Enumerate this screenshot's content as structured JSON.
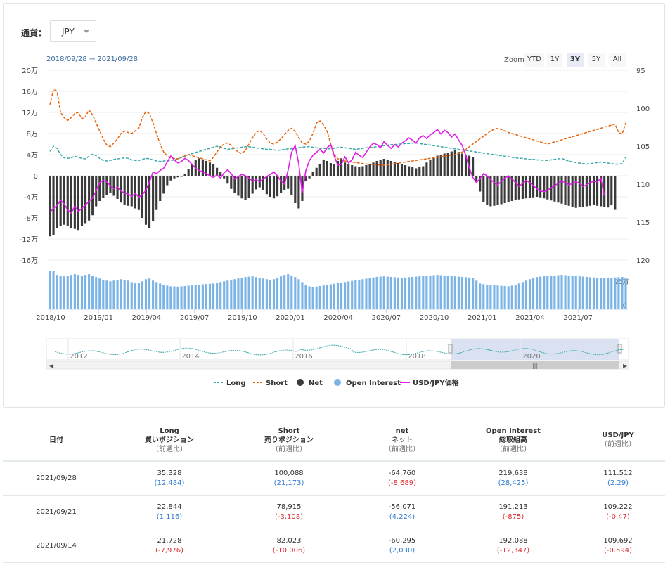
{
  "currency": {
    "label": "通貨：",
    "selected": "JPY"
  },
  "range": {
    "from": "2018/09/28",
    "arrow": "→",
    "to": "2021/09/28"
  },
  "zoom": {
    "label": "Zoom",
    "buttons": [
      "YTD",
      "1Y",
      "3Y",
      "5Y",
      "All"
    ],
    "active": "3Y"
  },
  "colors": {
    "long": "#3aa8a8",
    "short": "#e8650c",
    "net": "#3a3a3a",
    "open_interest": "#7ab3e6",
    "usdjpy": "#e21ce8"
  },
  "chart_data": {
    "type": "line",
    "y_left": {
      "ticks": [
        "20万",
        "16万",
        "12万",
        "8万",
        "4万",
        "0",
        "-4万",
        "-8万",
        "-12万",
        "-16万"
      ],
      "range": [
        -160000,
        200000
      ]
    },
    "y_right": {
      "ticks": [
        "95",
        "100",
        "105",
        "110",
        "115",
        "120"
      ],
      "range": [
        95,
        120
      ],
      "reversed": true
    },
    "oi_axis": {
      "ticks": [
        "25万",
        "0"
      ]
    },
    "x_ticks": [
      "2018/10",
      "2019/01",
      "2019/04",
      "2019/07",
      "2019/10",
      "2020/01",
      "2020/04",
      "2020/07",
      "2020/10",
      "2021/01",
      "2021/04",
      "2021/07"
    ],
    "navigator_ticks": [
      "2012",
      "2014",
      "2016",
      "2018",
      "2020"
    ],
    "legend": [
      "Long",
      "Short",
      "Net",
      "Open Interest",
      "USD/JPY価格"
    ],
    "series": [
      {
        "name": "Long",
        "kind": "line",
        "values": [
          46000,
          56000,
          52000,
          40000,
          34000,
          33000,
          34000,
          37000,
          35000,
          33000,
          32000,
          37000,
          41000,
          38000,
          33000,
          29000,
          28000,
          29000,
          31000,
          32000,
          33000,
          34000,
          33000,
          30000,
          29000,
          29000,
          31000,
          33000,
          32000,
          30000,
          28000,
          27000,
          28000,
          28000,
          29000,
          30000,
          32000,
          35000,
          37000,
          40000,
          42000,
          44000,
          46000,
          48000,
          50000,
          52000,
          54000,
          56000,
          55000,
          52000,
          50000,
          51000,
          52000,
          53000,
          54000,
          55000,
          55000,
          54000,
          53000,
          52000,
          51000,
          50000,
          50000,
          49000,
          48000,
          49000,
          50000,
          51000,
          51000,
          52000,
          53000,
          54000,
          55000,
          55000,
          54000,
          53000,
          52000,
          52000,
          51000,
          51000,
          52000,
          53000,
          54000,
          53000,
          52000,
          51000,
          50000,
          51000,
          52000,
          53000,
          53000,
          54000,
          55000,
          56000,
          57000,
          58000,
          59000,
          59000,
          60000,
          60000,
          61000,
          61000,
          62000,
          62000,
          61000,
          60000,
          59000,
          58000,
          57000,
          56000,
          55000,
          54000,
          53000,
          52000,
          51000,
          50000,
          49000,
          48000,
          47000,
          46000,
          45000,
          44000,
          43000,
          42000,
          41000,
          40000,
          39000,
          38000,
          37000,
          36000,
          35000,
          34000,
          33000,
          33000,
          32000,
          31000,
          31000,
          30000,
          30000,
          29000,
          29000,
          30000,
          31000,
          32000,
          33000,
          30000,
          28000,
          26000,
          25000,
          24000,
          23000,
          22000,
          23000,
          24000,
          25000,
          26000,
          25000,
          24000,
          23000,
          22000,
          21728,
          22844,
          35328
        ]
      },
      {
        "name": "Short",
        "kind": "line",
        "values": [
          135000,
          164000,
          160000,
          120000,
          110000,
          105000,
          110000,
          118000,
          120000,
          108000,
          112000,
          125000,
          115000,
          100000,
          85000,
          70000,
          58000,
          55000,
          62000,
          70000,
          80000,
          85000,
          82000,
          80000,
          85000,
          90000,
          110000,
          122000,
          118000,
          100000,
          80000,
          60000,
          45000,
          38000,
          34000,
          33000,
          32000,
          35000,
          38000,
          40000,
          38000,
          36000,
          34000,
          32000,
          30000,
          28000,
          35000,
          45000,
          55000,
          60000,
          62000,
          58000,
          50000,
          45000,
          42000,
          48000,
          60000,
          72000,
          82000,
          86000,
          80000,
          70000,
          62000,
          60000,
          64000,
          70000,
          78000,
          86000,
          90000,
          84000,
          72000,
          62000,
          60000,
          66000,
          80000,
          100000,
          104000,
          96000,
          84000,
          60000,
          40000,
          32000,
          30000,
          28000,
          27000,
          26000,
          25000,
          24000,
          23000,
          22000,
          22000,
          21000,
          21000,
          20000,
          20000,
          21000,
          22000,
          23000,
          24000,
          25000,
          26000,
          27000,
          28000,
          29000,
          30000,
          31000,
          32000,
          33000,
          34000,
          35000,
          36000,
          37000,
          38000,
          39000,
          40000,
          42000,
          45000,
          50000,
          55000,
          60000,
          65000,
          70000,
          75000,
          80000,
          85000,
          88000,
          90000,
          88000,
          85000,
          82000,
          80000,
          78000,
          76000,
          74000,
          72000,
          70000,
          68000,
          66000,
          64000,
          62000,
          60000,
          62000,
          64000,
          66000,
          68000,
          70000,
          72000,
          74000,
          76000,
          78000,
          80000,
          82000,
          84000,
          86000,
          88000,
          90000,
          92000,
          94000,
          96000,
          98000,
          82023,
          78915,
          100088
        ]
      },
      {
        "name": "Net",
        "kind": "column",
        "values": [
          -115000,
          -112000,
          -100000,
          -95000,
          -93000,
          -96000,
          -99000,
          -101000,
          -103000,
          -95000,
          -90000,
          -85000,
          -75000,
          -58000,
          -48000,
          -42000,
          -36000,
          -33000,
          -38000,
          -44000,
          -51000,
          -55000,
          -57000,
          -58000,
          -62000,
          -65000,
          -80000,
          -93000,
          -99000,
          -86000,
          -65000,
          -48000,
          -34000,
          -18000,
          -9000,
          -5000,
          -3000,
          -2000,
          4000,
          12000,
          22000,
          30000,
          33000,
          31000,
          28000,
          25000,
          22000,
          15000,
          8000,
          -5000,
          -15000,
          -25000,
          -32000,
          -38000,
          -43000,
          -46000,
          -42000,
          -34000,
          -26000,
          -22000,
          -28000,
          -35000,
          -40000,
          -43000,
          -39000,
          -33000,
          -28000,
          -25000,
          -36000,
          -52000,
          -62000,
          -48000,
          -10000,
          -5000,
          8000,
          15000,
          22000,
          30000,
          28000,
          24000,
          22000,
          28000,
          33000,
          25000,
          22000,
          20000,
          18000,
          16000,
          18000,
          20000,
          22000,
          25000,
          28000,
          30000,
          32000,
          30000,
          28000,
          26000,
          24000,
          22000,
          20000,
          18000,
          16000,
          14000,
          16000,
          18000,
          25000,
          30000,
          35000,
          38000,
          40000,
          42000,
          44000,
          46000,
          48000,
          45000,
          42000,
          40000,
          38000,
          36000,
          -10000,
          -30000,
          -50000,
          -55000,
          -58000,
          -57000,
          -56000,
          -54000,
          -52000,
          -50000,
          -48000,
          -46000,
          -45000,
          -44000,
          -43000,
          -42000,
          -41000,
          -40000,
          -41000,
          -43000,
          -45000,
          -47000,
          -49000,
          -51000,
          -53000,
          -55000,
          -57000,
          -59000,
          -61000,
          -60000,
          -59000,
          -58000,
          -57000,
          -56000,
          -57000,
          -58000,
          -59000,
          -60295,
          -56071,
          -64760
        ]
      },
      {
        "name": "Open Interest",
        "kind": "column",
        "axis": "oi",
        "values": [
          270000,
          270000,
          240000,
          235000,
          230000,
          235000,
          240000,
          245000,
          240000,
          235000,
          240000,
          245000,
          235000,
          225000,
          215000,
          205000,
          200000,
          195000,
          200000,
          205000,
          210000,
          205000,
          200000,
          190000,
          185000,
          185000,
          195000,
          210000,
          215000,
          200000,
          190000,
          180000,
          170000,
          165000,
          160000,
          160000,
          158000,
          160000,
          162000,
          165000,
          168000,
          170000,
          172000,
          174000,
          176000,
          178000,
          180000,
          185000,
          190000,
          195000,
          200000,
          205000,
          210000,
          215000,
          220000,
          225000,
          228000,
          230000,
          225000,
          220000,
          215000,
          210000,
          205000,
          210000,
          220000,
          230000,
          240000,
          245000,
          235000,
          225000,
          210000,
          190000,
          170000,
          160000,
          155000,
          158000,
          162000,
          166000,
          170000,
          174000,
          178000,
          182000,
          186000,
          190000,
          194000,
          198000,
          202000,
          206000,
          210000,
          214000,
          218000,
          222000,
          226000,
          228000,
          230000,
          228000,
          226000,
          224000,
          222000,
          220000,
          222000,
          224000,
          226000,
          228000,
          230000,
          232000,
          234000,
          236000,
          238000,
          240000,
          238000,
          236000,
          234000,
          232000,
          230000,
          228000,
          226000,
          224000,
          222000,
          220000,
          200000,
          180000,
          175000,
          172000,
          170000,
          168000,
          166000,
          164000,
          162000,
          160000,
          165000,
          170000,
          180000,
          190000,
          200000,
          210000,
          220000,
          225000,
          228000,
          230000,
          232000,
          234000,
          236000,
          238000,
          240000,
          238000,
          236000,
          234000,
          232000,
          230000,
          228000,
          226000,
          224000,
          222000,
          220000,
          218000,
          216000,
          218000,
          220000,
          222000,
          224000,
          226000,
          219638
        ]
      },
      {
        "name": "USD/JPY価格",
        "kind": "line",
        "axis": "right",
        "values": [
          113.7,
          113.2,
          112.8,
          112.1,
          112.6,
          113.4,
          113.8,
          112.9,
          113.6,
          113.2,
          112.7,
          112.3,
          111.8,
          110.9,
          109.8,
          109.5,
          109.7,
          110.2,
          110.6,
          110.4,
          110.9,
          111.2,
          111.3,
          111.6,
          111.2,
          111.7,
          111.4,
          110.8,
          109.7,
          108.4,
          108.6,
          108.2,
          107.9,
          107.1,
          106.3,
          106.8,
          107.2,
          107.0,
          106.6,
          106.9,
          107.4,
          107.9,
          108.2,
          108.4,
          108.6,
          108.9,
          109.1,
          108.8,
          109.2,
          108.5,
          108.1,
          108.6,
          109.3,
          109.0,
          108.7,
          108.9,
          109.2,
          109.6,
          109.4,
          109.7,
          109.3,
          109.0,
          108.7,
          108.4,
          108.9,
          109.6,
          110.0,
          108.2,
          105.8,
          104.9,
          107.3,
          111.2,
          108.2,
          106.9,
          106.2,
          105.8,
          105.4,
          105.9,
          105.2,
          104.8,
          106.3,
          107.5,
          107.4,
          106.4,
          107.2,
          106.8,
          105.8,
          106.2,
          106.5,
          105.8,
          105.1,
          104.6,
          104.8,
          105.2,
          104.4,
          104.9,
          105.3,
          104.8,
          105.1,
          104.6,
          104.3,
          103.9,
          104.2,
          104.6,
          103.9,
          103.6,
          104.0,
          103.5,
          103.2,
          102.8,
          103.4,
          102.9,
          103.2,
          103.8,
          103.4,
          104.2,
          104.9,
          106.2,
          107.9,
          109.1,
          109.8,
          109.3,
          108.6,
          108.9,
          109.4,
          109.8,
          110.1,
          109.6,
          109.2,
          108.9,
          109.3,
          109.8,
          110.3,
          109.9,
          109.5,
          109.8,
          110.2,
          110.6,
          110.9,
          111.0,
          110.8,
          110.5,
          110.2,
          109.9,
          109.6,
          109.8,
          110.1,
          109.9,
          109.7,
          109.9,
          110.3,
          110.1,
          109.8,
          109.6,
          109.692,
          109.222,
          111.512
        ]
      }
    ]
  },
  "table": {
    "headers": [
      {
        "l1": "日付",
        "l2": "",
        "l3": ""
      },
      {
        "l1": "Long",
        "l2": "買いポジション",
        "l3": "（前週比）"
      },
      {
        "l1": "Short",
        "l2": "売りポジション",
        "l3": "（前週比）"
      },
      {
        "l1": "net",
        "l2": "ネット",
        "l3": "（前週比）"
      },
      {
        "l1": "Open Interest",
        "l2": "総取組高",
        "l3": "（前週比）"
      },
      {
        "l1": "USD/JPY",
        "l2": "（前週比）",
        "l3": ""
      }
    ],
    "rows": [
      {
        "date": "2021/09/28",
        "long": "35,328",
        "long_chg": "(12,484)",
        "short": "100,088",
        "short_chg": "(21,173)",
        "net": "-64,760",
        "net_chg": "(-8,689)",
        "oi": "219,638",
        "oi_chg": "(28,425)",
        "usdjpy": "111.512",
        "usdjpy_chg": "(2.29)"
      },
      {
        "date": "2021/09/21",
        "long": "22,844",
        "long_chg": "(1,116)",
        "short": "78,915",
        "short_chg": "(-3,108)",
        "net": "-56,071",
        "net_chg": "(4,224)",
        "oi": "191,213",
        "oi_chg": "(-875)",
        "usdjpy": "109.222",
        "usdjpy_chg": "(-0.47)"
      },
      {
        "date": "2021/09/14",
        "long": "21,728",
        "long_chg": "(-7,976)",
        "short": "82,023",
        "short_chg": "(-10,006)",
        "net": "-60,295",
        "net_chg": "(2,030)",
        "oi": "192,088",
        "oi_chg": "(-12,347)",
        "usdjpy": "109.692",
        "usdjpy_chg": "(-0.594)"
      }
    ]
  }
}
